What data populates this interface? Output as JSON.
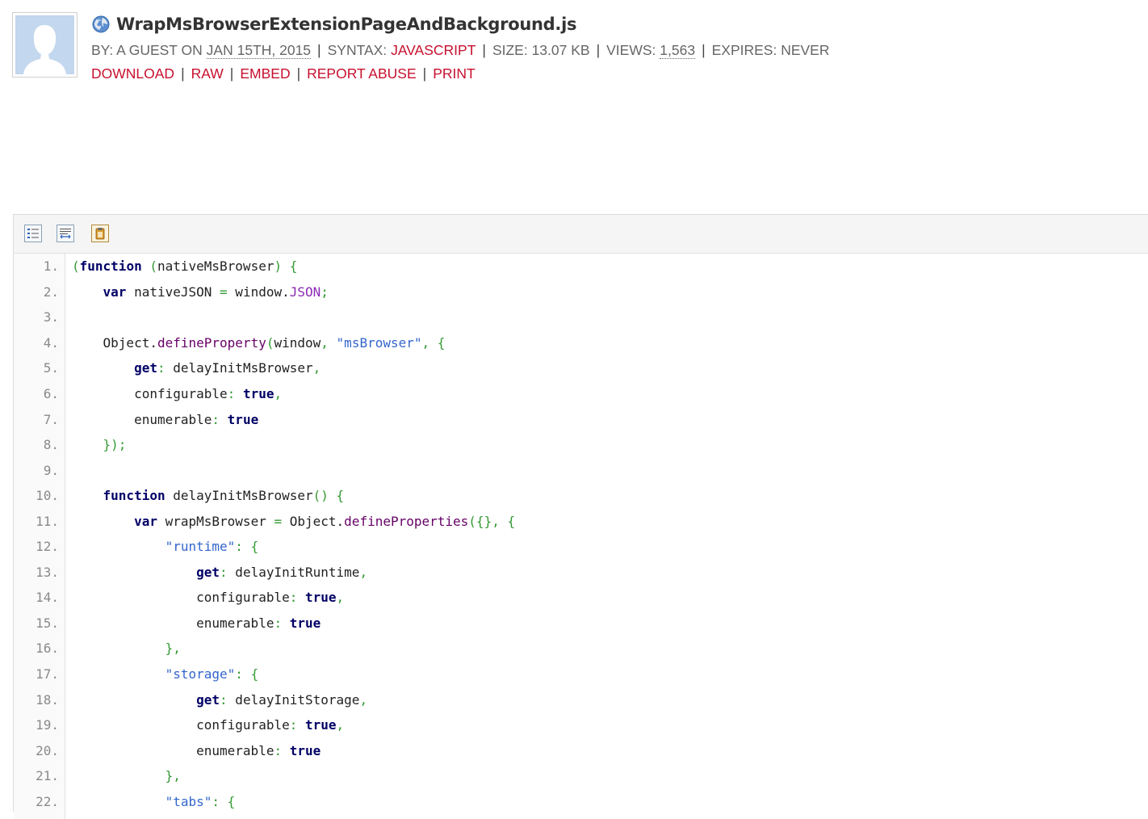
{
  "paste": {
    "title": "WrapMsBrowserExtensionPageAndBackground.js",
    "meta": {
      "by_label": "BY: A GUEST ON",
      "date": "JAN 15TH, 2015",
      "syntax_label": "SYNTAX:",
      "syntax_value": "JAVASCRIPT",
      "size": "SIZE: 13.07 KB",
      "views_label": "VIEWS:",
      "views_value": "1,563",
      "expires": "EXPIRES: NEVER"
    },
    "actions": {
      "download": "DOWNLOAD",
      "raw": "RAW",
      "embed": "EMBED",
      "report": "REPORT ABUSE",
      "print": "PRINT"
    },
    "separator": "|"
  },
  "icons": {
    "globe": "globe-icon",
    "avatar": "guest-avatar",
    "toolbar": [
      "toggle-line-numbers-icon",
      "toggle-wrap-icon",
      "copy-clipboard-icon"
    ]
  },
  "colors": {
    "accent": "#c8102e",
    "keyword": "#000066",
    "string": "#3366cc",
    "punct": "#339933",
    "method": "#660066"
  },
  "code": {
    "line_numbers": [
      "1.",
      "2.",
      "3.",
      "4.",
      "5.",
      "6.",
      "7.",
      "8.",
      "9.",
      "10.",
      "11.",
      "12.",
      "13.",
      "14.",
      "15.",
      "16.",
      "17.",
      "18.",
      "19.",
      "20.",
      "21.",
      "22."
    ],
    "lines": [
      [
        [
          "pu",
          "("
        ],
        [
          "kw",
          "function"
        ],
        [
          "",
          ""
        ],
        [
          "pu",
          " ("
        ],
        [
          "",
          "nativeMsBrowser"
        ],
        [
          "pu",
          ")"
        ],
        [
          "",
          " "
        ],
        [
          "pu",
          "{"
        ]
      ],
      [
        [
          "",
          "    "
        ],
        [
          "kw",
          "var"
        ],
        [
          "",
          " nativeJSON "
        ],
        [
          "pu",
          "="
        ],
        [
          "",
          " window."
        ],
        [
          "jn",
          "JSON"
        ],
        [
          "pu",
          ";"
        ]
      ],
      [],
      [
        [
          "",
          "    Object."
        ],
        [
          "me",
          "defineProperty"
        ],
        [
          "pu",
          "("
        ],
        [
          "",
          "window"
        ],
        [
          "pu",
          ","
        ],
        [
          "",
          " "
        ],
        [
          "st",
          "\"msBrowser\""
        ],
        [
          "pu",
          ","
        ],
        [
          "",
          " "
        ],
        [
          "pu",
          "{"
        ]
      ],
      [
        [
          "",
          "        "
        ],
        [
          "kw",
          "get"
        ],
        [
          "pu",
          ":"
        ],
        [
          "",
          " delayInitMsBrowser"
        ],
        [
          "pu",
          ","
        ]
      ],
      [
        [
          "",
          "        configurable"
        ],
        [
          "pu",
          ":"
        ],
        [
          "",
          " "
        ],
        [
          "kw",
          "true"
        ],
        [
          "pu",
          ","
        ]
      ],
      [
        [
          "",
          "        enumerable"
        ],
        [
          "pu",
          ":"
        ],
        [
          "",
          " "
        ],
        [
          "kw",
          "true"
        ]
      ],
      [
        [
          "",
          "    "
        ],
        [
          "pu",
          "});"
        ]
      ],
      [],
      [
        [
          "",
          "    "
        ],
        [
          "kw",
          "function"
        ],
        [
          "",
          " delayInitMsBrowser"
        ],
        [
          "pu",
          "()"
        ],
        [
          "",
          " "
        ],
        [
          "pu",
          "{"
        ]
      ],
      [
        [
          "",
          "        "
        ],
        [
          "kw",
          "var"
        ],
        [
          "",
          " wrapMsBrowser "
        ],
        [
          "pu",
          "="
        ],
        [
          "",
          " Object."
        ],
        [
          "me",
          "defineProperties"
        ],
        [
          "pu",
          "({},"
        ],
        [
          "",
          " "
        ],
        [
          "pu",
          "{"
        ]
      ],
      [
        [
          "",
          "            "
        ],
        [
          "st",
          "\"runtime\""
        ],
        [
          "pu",
          ":"
        ],
        [
          "",
          " "
        ],
        [
          "pu",
          "{"
        ]
      ],
      [
        [
          "",
          "                "
        ],
        [
          "kw",
          "get"
        ],
        [
          "pu",
          ":"
        ],
        [
          "",
          " delayInitRuntime"
        ],
        [
          "pu",
          ","
        ]
      ],
      [
        [
          "",
          "                configurable"
        ],
        [
          "pu",
          ":"
        ],
        [
          "",
          " "
        ],
        [
          "kw",
          "true"
        ],
        [
          "pu",
          ","
        ]
      ],
      [
        [
          "",
          "                enumerable"
        ],
        [
          "pu",
          ":"
        ],
        [
          "",
          " "
        ],
        [
          "kw",
          "true"
        ]
      ],
      [
        [
          "",
          "            "
        ],
        [
          "pu",
          "},"
        ]
      ],
      [
        [
          "",
          "            "
        ],
        [
          "st",
          "\"storage\""
        ],
        [
          "pu",
          ":"
        ],
        [
          "",
          " "
        ],
        [
          "pu",
          "{"
        ]
      ],
      [
        [
          "",
          "                "
        ],
        [
          "kw",
          "get"
        ],
        [
          "pu",
          ":"
        ],
        [
          "",
          " delayInitStorage"
        ],
        [
          "pu",
          ","
        ]
      ],
      [
        [
          "",
          "                configurable"
        ],
        [
          "pu",
          ":"
        ],
        [
          "",
          " "
        ],
        [
          "kw",
          "true"
        ],
        [
          "pu",
          ","
        ]
      ],
      [
        [
          "",
          "                enumerable"
        ],
        [
          "pu",
          ":"
        ],
        [
          "",
          " "
        ],
        [
          "kw",
          "true"
        ]
      ],
      [
        [
          "",
          "            "
        ],
        [
          "pu",
          "},"
        ]
      ],
      [
        [
          "",
          "            "
        ],
        [
          "st",
          "\"tabs\""
        ],
        [
          "pu",
          ":"
        ],
        [
          "",
          " "
        ],
        [
          "pu",
          "{"
        ]
      ]
    ]
  }
}
